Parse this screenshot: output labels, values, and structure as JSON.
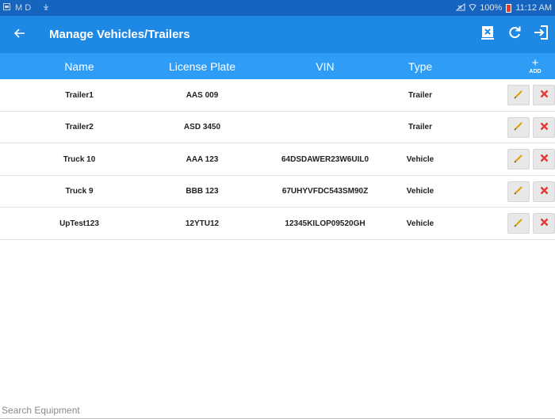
{
  "status_bar": {
    "left_text": "M D",
    "battery": "100%",
    "time": "11:12 AM"
  },
  "app_bar": {
    "title": "Manage Vehicles/Trailers",
    "icons": [
      "back-arrow-icon",
      "clear-equipment-icon",
      "refresh-icon",
      "logout-icon"
    ]
  },
  "table": {
    "columns": [
      "Name",
      "License Plate",
      "VIN",
      "Type"
    ],
    "add_label": "ADD",
    "rows": [
      {
        "name": "Trailer1",
        "plate": "AAS 009",
        "vin": "",
        "type": "Trailer"
      },
      {
        "name": "Trailer2",
        "plate": "ASD 3450",
        "vin": "",
        "type": "Trailer"
      },
      {
        "name": "Truck 10",
        "plate": "AAA 123",
        "vin": "64DSDAWER23W6UIL0",
        "type": "Vehicle"
      },
      {
        "name": "Truck 9",
        "plate": "BBB 123",
        "vin": "67UHYVFDC543SM90Z",
        "type": "Vehicle"
      },
      {
        "name": "UpTest123",
        "plate": "12YTU12",
        "vin": "12345KILOP09520GH",
        "type": "Vehicle"
      }
    ]
  },
  "search": {
    "placeholder": "Search Equipment",
    "value": ""
  },
  "colors": {
    "status_bar": "#1565c0",
    "app_bar": "#1e88e5",
    "header_row": "#2f9df5",
    "edit_pencil": "#e0a100",
    "delete_x": "#e53935"
  }
}
